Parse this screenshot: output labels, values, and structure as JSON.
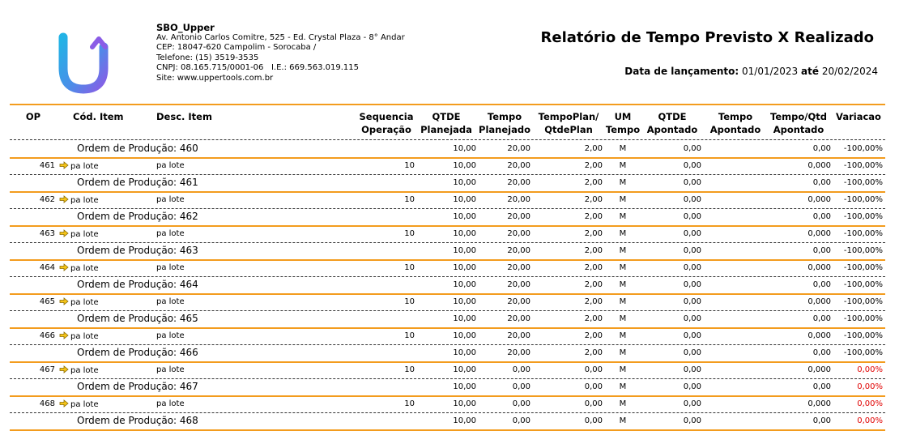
{
  "company": {
    "name": "SBO_Upper",
    "address": "Av. Antonio Carlos Comitre, 525 - Ed. Crystal Plaza - 8° Andar",
    "cep": "CEP: 18047-620 Campolim - Sorocaba /",
    "phone": "Telefone: (15) 3519-3535",
    "cnpj": "CNPJ:  08.165.715/0001-06",
    "ie": "I.E.:  669.563.019.115",
    "site": "Site: www.uppertools.com.br"
  },
  "report": {
    "title": "Relatório de Tempo Previsto X Realizado",
    "period_label": "Data de lançamento:",
    "date_from": "01/01/2023",
    "until": "até",
    "date_to": "20/02/2024"
  },
  "columns": {
    "op": "OP",
    "cod": "Cód. Item",
    "desc": "Desc. Item",
    "seq1": "Sequencia",
    "seq2": "Operação",
    "qtde1": "QTDE",
    "qtde2": "Planejada",
    "tp1": "Tempo",
    "tp2": "Planejado",
    "tpq1": "TempoPlan/",
    "tpq2": "QtdePlan",
    "um1": "UM",
    "um2": "Tempo",
    "qa1": "QTDE",
    "qa2": "Apontado",
    "ta1": "Tempo",
    "ta2": "Apontado",
    "tqa1": "Tempo/Qtd",
    "tqa2": "Apontado",
    "var": "Variacao"
  },
  "colors": {
    "accent": "#f39c1e",
    "negative": "#e00000"
  },
  "rows": [
    {
      "kind": "summary",
      "ordem": "Ordem de Produção: 460",
      "qtde": "10,00",
      "tempo": "20,00",
      "tpq": "2,00",
      "um": "M",
      "qa": "0,00",
      "ta": "",
      "tqa": "0,00",
      "var": "-100,00%",
      "red": false
    },
    {
      "kind": "item",
      "op": "461",
      "cod": "pa lote",
      "desc": "pa lote",
      "seq": "10",
      "qtde": "10,00",
      "tempo": "20,00",
      "tpq": "2,00",
      "um": "M",
      "qa": "0,00",
      "ta": "",
      "tqa": "0,000",
      "var": "-100,00%",
      "red": false
    },
    {
      "kind": "summary",
      "ordem": "Ordem de Produção: 461",
      "qtde": "10,00",
      "tempo": "20,00",
      "tpq": "2,00",
      "um": "M",
      "qa": "0,00",
      "ta": "",
      "tqa": "0,00",
      "var": "-100,00%",
      "red": false
    },
    {
      "kind": "item",
      "op": "462",
      "cod": "pa lote",
      "desc": "pa lote",
      "seq": "10",
      "qtde": "10,00",
      "tempo": "20,00",
      "tpq": "2,00",
      "um": "M",
      "qa": "0,00",
      "ta": "",
      "tqa": "0,000",
      "var": "-100,00%",
      "red": false
    },
    {
      "kind": "summary",
      "ordem": "Ordem de Produção: 462",
      "qtde": "10,00",
      "tempo": "20,00",
      "tpq": "2,00",
      "um": "M",
      "qa": "0,00",
      "ta": "",
      "tqa": "0,00",
      "var": "-100,00%",
      "red": false
    },
    {
      "kind": "item",
      "op": "463",
      "cod": "pa lote",
      "desc": "pa lote",
      "seq": "10",
      "qtde": "10,00",
      "tempo": "20,00",
      "tpq": "2,00",
      "um": "M",
      "qa": "0,00",
      "ta": "",
      "tqa": "0,000",
      "var": "-100,00%",
      "red": false
    },
    {
      "kind": "summary",
      "ordem": "Ordem de Produção: 463",
      "qtde": "10,00",
      "tempo": "20,00",
      "tpq": "2,00",
      "um": "M",
      "qa": "0,00",
      "ta": "",
      "tqa": "0,00",
      "var": "-100,00%",
      "red": false
    },
    {
      "kind": "item",
      "op": "464",
      "cod": "pa lote",
      "desc": "pa lote",
      "seq": "10",
      "qtde": "10,00",
      "tempo": "20,00",
      "tpq": "2,00",
      "um": "M",
      "qa": "0,00",
      "ta": "",
      "tqa": "0,000",
      "var": "-100,00%",
      "red": false
    },
    {
      "kind": "summary",
      "ordem": "Ordem de Produção: 464",
      "qtde": "10,00",
      "tempo": "20,00",
      "tpq": "2,00",
      "um": "M",
      "qa": "0,00",
      "ta": "",
      "tqa": "0,00",
      "var": "-100,00%",
      "red": false
    },
    {
      "kind": "item",
      "op": "465",
      "cod": "pa lote",
      "desc": "pa lote",
      "seq": "10",
      "qtde": "10,00",
      "tempo": "20,00",
      "tpq": "2,00",
      "um": "M",
      "qa": "0,00",
      "ta": "",
      "tqa": "0,000",
      "var": "-100,00%",
      "red": false
    },
    {
      "kind": "summary",
      "ordem": "Ordem de Produção: 465",
      "qtde": "10,00",
      "tempo": "20,00",
      "tpq": "2,00",
      "um": "M",
      "qa": "0,00",
      "ta": "",
      "tqa": "0,00",
      "var": "-100,00%",
      "red": false
    },
    {
      "kind": "item",
      "op": "466",
      "cod": "pa lote",
      "desc": "pa lote",
      "seq": "10",
      "qtde": "10,00",
      "tempo": "20,00",
      "tpq": "2,00",
      "um": "M",
      "qa": "0,00",
      "ta": "",
      "tqa": "0,000",
      "var": "-100,00%",
      "red": false
    },
    {
      "kind": "summary",
      "ordem": "Ordem de Produção: 466",
      "qtde": "10,00",
      "tempo": "20,00",
      "tpq": "2,00",
      "um": "M",
      "qa": "0,00",
      "ta": "",
      "tqa": "0,00",
      "var": "-100,00%",
      "red": false
    },
    {
      "kind": "item",
      "op": "467",
      "cod": "pa lote",
      "desc": "pa lote",
      "seq": "10",
      "qtde": "10,00",
      "tempo": "0,00",
      "tpq": "0,00",
      "um": "M",
      "qa": "0,00",
      "ta": "",
      "tqa": "0,000",
      "var": "0,00%",
      "red": true
    },
    {
      "kind": "summary",
      "ordem": "Ordem de Produção: 467",
      "qtde": "10,00",
      "tempo": "0,00",
      "tpq": "0,00",
      "um": "M",
      "qa": "0,00",
      "ta": "",
      "tqa": "0,00",
      "var": "0,00%",
      "red": true
    },
    {
      "kind": "item",
      "op": "468",
      "cod": "pa lote",
      "desc": "pa lote",
      "seq": "10",
      "qtde": "10,00",
      "tempo": "0,00",
      "tpq": "0,00",
      "um": "M",
      "qa": "0,00",
      "ta": "",
      "tqa": "0,000",
      "var": "0,00%",
      "red": true
    },
    {
      "kind": "summary",
      "ordem": "Ordem de Produção: 468",
      "qtde": "10,00",
      "tempo": "0,00",
      "tpq": "0,00",
      "um": "M",
      "qa": "0,00",
      "ta": "",
      "tqa": "0,00",
      "var": "0,00%",
      "red": true
    }
  ]
}
